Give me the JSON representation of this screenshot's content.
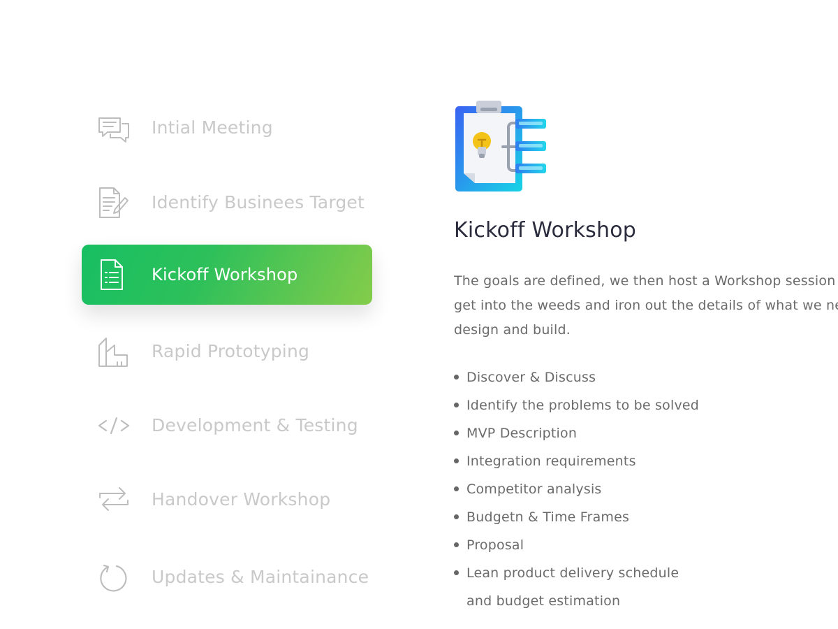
{
  "steps": [
    {
      "label": "Intial Meeting",
      "icon": "chat-bubbles-icon",
      "active": false
    },
    {
      "label": "Identify Businees Target",
      "icon": "document-pen-icon",
      "active": false
    },
    {
      "label": "Kickoff Workshop",
      "icon": "document-list-icon",
      "active": true
    },
    {
      "label": "Rapid Prototyping",
      "icon": "blueprint-icon",
      "active": false
    },
    {
      "label": "Development & Testing",
      "icon": "code-brackets-icon",
      "active": false
    },
    {
      "label": "Handover Workshop",
      "icon": "exchange-arrows-icon",
      "active": false
    },
    {
      "label": "Updates & Maintainance",
      "icon": "refresh-icon",
      "active": false
    }
  ],
  "detail": {
    "icon": "clipboard-lightbulb-icon",
    "title": "Kickoff Workshop",
    "description": "The goals are defined, we then host a Workshop session where we get into the weeds and iron out the details of what we need to design and build.",
    "bullets": [
      "Discover & Discuss",
      "Identify the problems to be solved",
      "MVP Description",
      "Integration requirements",
      "Competitor analysis",
      "Budgetn & Time Frames",
      "Proposal",
      "Lean product delivery schedule and budget estimation"
    ]
  },
  "colors": {
    "active_gradient_start": "#17bf63",
    "active_gradient_end": "#84cc4a",
    "inactive_text": "#c9c9c9",
    "title_text": "#2a2b3d",
    "body_text": "#6b6b6b",
    "icon_blue": "#2a7ff0",
    "icon_cyan": "#1fd2e8"
  }
}
